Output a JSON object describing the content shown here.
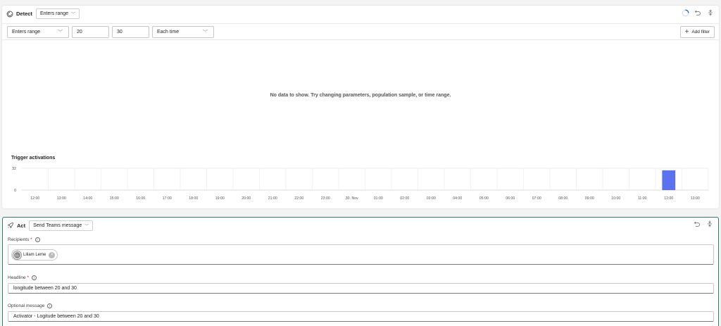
{
  "detect": {
    "title": "Detect",
    "mode_dropdown": "Enters range",
    "filter": {
      "condition": "Enters range",
      "min": "20",
      "max": "30",
      "frequency": "Each time",
      "add_filter_label": "Add filter"
    },
    "no_data_message": "No data to show. Try changing parameters, population sample, or time range."
  },
  "chart_data": {
    "type": "bar",
    "title": "Trigger activations",
    "ylim": [
      0,
      32
    ],
    "y_ticks": [
      "32",
      "0"
    ],
    "categories": [
      "12:00",
      "13:00",
      "14:00",
      "15:00",
      "16:00",
      "17:00",
      "18:00",
      "19:00",
      "20:00",
      "21:00",
      "22:00",
      "23:00",
      "30. Nov",
      "01:00",
      "02:00",
      "03:00",
      "04:00",
      "05:00",
      "06:00",
      "07:00",
      "08:00",
      "09:00",
      "10:00",
      "11:00",
      "12:00",
      "13:00"
    ],
    "values": [
      0,
      0,
      0,
      0,
      0,
      0,
      0,
      0,
      0,
      0,
      0,
      0,
      0,
      0,
      0,
      0,
      0,
      0,
      0,
      0,
      0,
      0,
      0,
      0,
      29,
      0
    ],
    "bar_color": "#5b72ee",
    "grid": true
  },
  "act": {
    "title": "Act",
    "action_dropdown": "Send Teams message",
    "recipients_label": "Recipients",
    "recipient": {
      "initials": "LL",
      "name": "Liliam Leme"
    },
    "headline_label": "Headline",
    "headline_value": "longitude between 20 and 30",
    "optional_label": "Optional message",
    "optional_value": "Activator - Logitude between  20 and 30"
  },
  "colors": {
    "accent_border": "#2e7d5b",
    "required": "#c50f1f"
  }
}
